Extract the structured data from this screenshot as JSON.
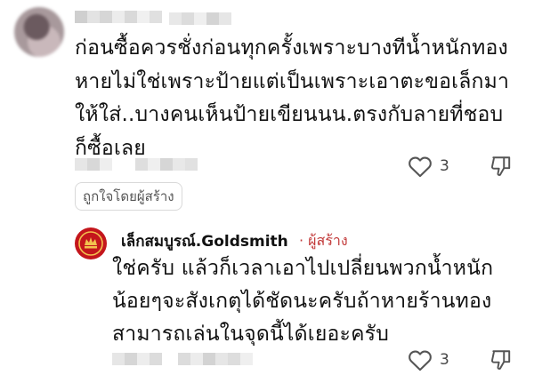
{
  "comment": {
    "text": "ก่อนซื้อควรชั่งก่อนทุกครั้งเพราะบางทีน้ำหนักทองหายไม่ใช่เพราะป้ายแต่เป็นเพราะเอาตะขอเล็กมาให้ใส่..บางคนเห็นป้ายเขียนนน.ตรงกับลายที่ชอบก็ซื้อเลย",
    "lines": [
      "ก่อนซื้อควรชั่งก่อนทุกครั้งเพราะบางทีน้ำหนักทอง",
      "หายไม่ใช่เพราะป้ายแต่เป็นเพราะเอาตะขอเล็กมา",
      "ให้ใส่..บางคนเห็นป้ายเขียนนน.ตรงกับลายที่ชอบ",
      "ก็ซื้อเลย"
    ],
    "like_count": "3",
    "liked_by_creator": "ถูกใจโดยผู้สร้าง"
  },
  "reply": {
    "author": "เล็กสมบูรณ์.Goldsmith",
    "badge": "· ผู้สร้าง",
    "lines": [
      "ใช่ครับ แล้วก็เวลาเอาไปเปลี่ยนพวกน้ำหนัก",
      "น้อยๆจะสังเกตุได้ชัดนะครับถ้าหายร้านทอง",
      "สามารถเล่นในจุดนี้ได้เยอะครับ"
    ],
    "like_count": "3"
  },
  "colors": {
    "creator_badge": "#c23a3a",
    "reply_avatar_bg": "#c4161c",
    "icon_gray": "#555555"
  },
  "icons": {
    "like": "heart-outline-icon",
    "dislike": "thumbs-down-outline-icon"
  }
}
